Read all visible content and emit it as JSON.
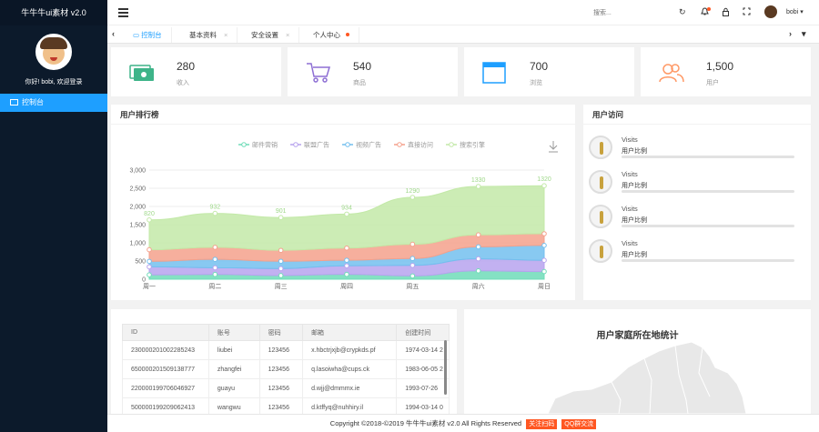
{
  "sidebar": {
    "brand": "牛牛牛ui素材 v2.0",
    "greeting": "你好! bobi, 欢迎登录",
    "nav": [
      {
        "label": "控制台",
        "icon": "monitor-icon"
      }
    ]
  },
  "topbar": {
    "search_placeholder": "搜索...",
    "icons": [
      "refresh-icon",
      "bell-icon",
      "lock-icon",
      "fullscreen-icon"
    ],
    "user_name": "bobi"
  },
  "tabs": [
    {
      "label": "控制台",
      "active": true,
      "closable": false
    },
    {
      "label": "基本资料",
      "active": false,
      "closable": true
    },
    {
      "label": "安全设置",
      "active": false,
      "closable": true
    },
    {
      "label": "个人中心",
      "active": false,
      "closable": false,
      "live": true
    }
  ],
  "stats": [
    {
      "value": "280",
      "label": "收入",
      "icon": "cash-icon",
      "color": "#3eb489"
    },
    {
      "value": "540",
      "label": "商品",
      "icon": "cart-icon",
      "color": "#8e6fd4"
    },
    {
      "value": "700",
      "label": "浏览",
      "icon": "browser-icon",
      "color": "#1e9fff"
    },
    {
      "value": "1,500",
      "label": "用户",
      "icon": "users-icon",
      "color": "#ff9966"
    }
  ],
  "ranking_panel": {
    "title": "用户排行榜"
  },
  "visits_panel": {
    "title": "用户访问",
    "items": [
      {
        "title": "Visits",
        "subtitle": "用户比例",
        "progress": 0
      },
      {
        "title": "Visits",
        "subtitle": "用户比例",
        "progress": 0
      },
      {
        "title": "Visits",
        "subtitle": "用户比例",
        "progress": 0
      },
      {
        "title": "Visits",
        "subtitle": "用户比例",
        "progress": 0
      }
    ]
  },
  "chart_data": {
    "type": "area",
    "stacked": true,
    "categories": [
      "周一",
      "周二",
      "周三",
      "周四",
      "周五",
      "周六",
      "周日"
    ],
    "ylim": [
      0,
      3000
    ],
    "yticks": [
      "0",
      "500",
      "1,000",
      "1,500",
      "2,000",
      "2,500",
      "3,000"
    ],
    "legend_position": "top",
    "series": [
      {
        "name": "邮件营销",
        "color": "#6fdcb8",
        "values": [
          120,
          132,
          101,
          134,
          90,
          230,
          210
        ]
      },
      {
        "name": "联盟广告",
        "color": "#b7a3ee",
        "values": [
          220,
          182,
          191,
          234,
          290,
          330,
          310
        ]
      },
      {
        "name": "视频广告",
        "color": "#73bfee",
        "values": [
          150,
          232,
          201,
          154,
          190,
          330,
          410
        ]
      },
      {
        "name": "直接访问",
        "color": "#f4a18c",
        "values": [
          320,
          332,
          301,
          334,
          390,
          330,
          320
        ]
      },
      {
        "name": "搜索引擎",
        "color": "#c3e9a8",
        "values": [
          820,
          932,
          901,
          934,
          1290,
          1330,
          1320
        ]
      }
    ],
    "data_labels": [
      "820",
      "932",
      "901",
      "934",
      "1290",
      "1330",
      "1320"
    ]
  },
  "table": {
    "columns": [
      "ID",
      "账号",
      "密码",
      "邮箱",
      "创建时间"
    ],
    "rows": [
      [
        "230000201002285243",
        "liubei",
        "123456",
        "x.hbctrjxjb@crypkds.pf",
        "1974-03-14 2"
      ],
      [
        "650000201509138777",
        "zhangfei",
        "123456",
        "q.lasoiwha@cups.ck",
        "1983-06-05 2"
      ],
      [
        "220000199706046927",
        "guayu",
        "123456",
        "d.wjj@dmmmx.ie",
        "1993-07-26"
      ],
      [
        "500000199209062413",
        "wangwu",
        "123456",
        "d.ktffyq@nuhhiry.il",
        "1994-03-14 0"
      ]
    ]
  },
  "map_panel": {
    "title": "用户家庭所在地统计"
  },
  "footer": {
    "text": "Copyright ©2018-©2019 牛牛牛ui素材 v2.0 All Rights Reserved",
    "btn_follow": "关注扫码",
    "btn_qq": "QQ群交流"
  }
}
